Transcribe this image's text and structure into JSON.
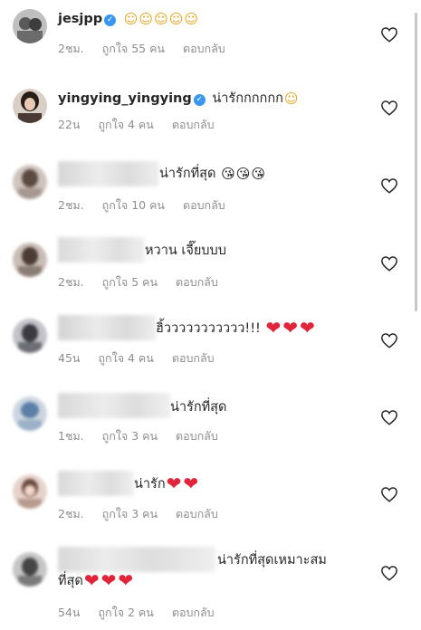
{
  "comments": [
    {
      "username": "jesjpp",
      "verified": true,
      "text": "",
      "emojis": [
        "☺",
        "☺",
        "☺",
        "☺",
        "☺"
      ],
      "time": "2ชม.",
      "likes": "ถูกใจ 55 คน",
      "reply": "ตอบกลับ"
    },
    {
      "username": "yingying_yingying",
      "verified": true,
      "text": "น่ารักกกกกก",
      "emojis": [
        "☺"
      ],
      "time": "22น",
      "likes": "ถูกใจ 4 คน",
      "reply": "ตอบกลับ"
    },
    {
      "username": "",
      "verified": false,
      "text": "น่ารักที่สุด",
      "emojis": [
        "😘",
        "😘",
        "😘"
      ],
      "time": "2ชม.",
      "likes": "ถูกใจ 10 คน",
      "reply": "ตอบกลับ"
    },
    {
      "username": "",
      "verified": false,
      "text": "หวาน เจี๊ยบบบ",
      "emojis": [],
      "time": "2ชม.",
      "likes": "ถูกใจ 5 คน",
      "reply": "ตอบกลับ"
    },
    {
      "username": "",
      "verified": false,
      "text": "ฮิ้ววววววววววว!!!",
      "emojis": [
        "❤",
        "❤",
        "❤"
      ],
      "time": "45น",
      "likes": "ถูกใจ 4 คน",
      "reply": "ตอบกลับ"
    },
    {
      "username": "",
      "verified": false,
      "text": "น่ารักที่สุด",
      "emojis": [],
      "time": "1ชม.",
      "likes": "ถูกใจ 3 คน",
      "reply": "ตอบกลับ"
    },
    {
      "username": "",
      "verified": false,
      "text": "น่ารัก",
      "emojis": [
        "❤",
        "❤"
      ],
      "time": "2ชม.",
      "likes": "ถูกใจ 3 คน",
      "reply": "ตอบกลับ"
    },
    {
      "username": "",
      "verified": false,
      "text": "น่ารักที่สุดเหมาะสม",
      "text2": "ที่สุด",
      "emojis": [
        "❤",
        "❤",
        "❤"
      ],
      "time": "54น",
      "likes": "ถูกใจ 2 คน",
      "reply": "ตอบกลับ"
    }
  ],
  "colors": {
    "verified": "#3897f0",
    "heart": "#e0243a",
    "meta": "#8e8e8e",
    "text": "#262626"
  },
  "icons": {
    "like": "heart-outline-icon",
    "verified": "verified-badge-icon"
  }
}
